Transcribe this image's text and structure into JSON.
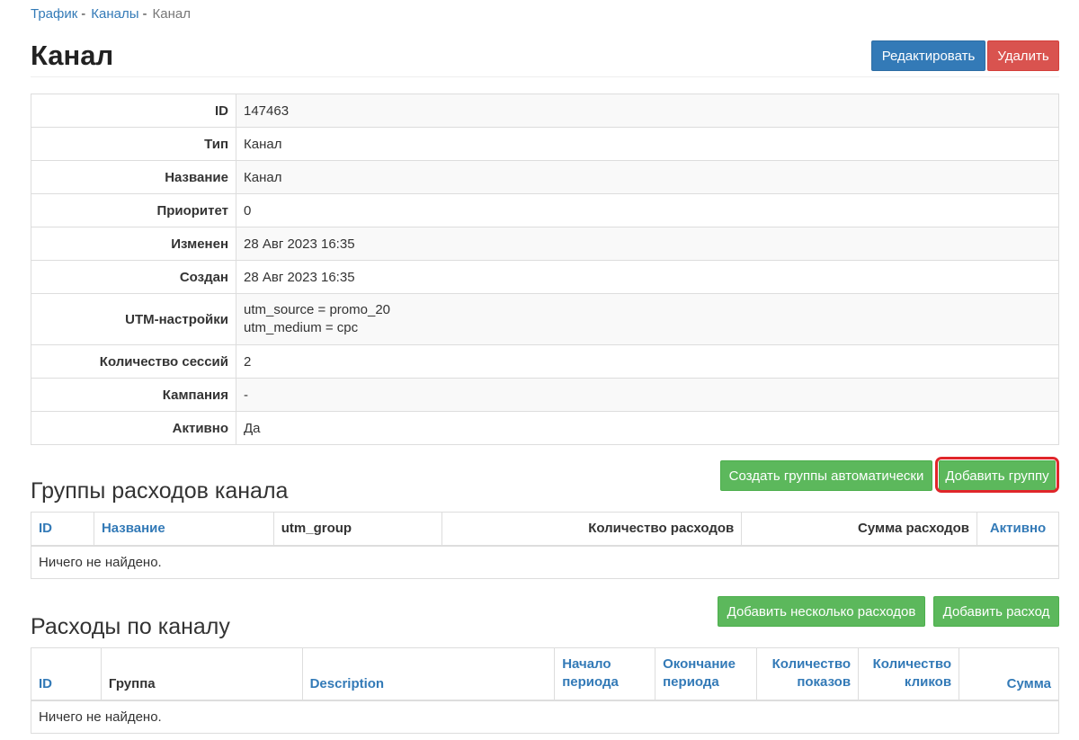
{
  "breadcrumb": {
    "items": [
      "Трафик",
      "Каналы"
    ],
    "current": "Канал",
    "sep": "-"
  },
  "page": {
    "title": "Канал"
  },
  "actions": {
    "edit": "Редактировать",
    "delete": "Удалить"
  },
  "detail": {
    "rows": [
      {
        "label": "ID",
        "value": "147463"
      },
      {
        "label": "Тип",
        "value": "Канал"
      },
      {
        "label": "Название",
        "value": "Канал"
      },
      {
        "label": "Приоритет",
        "value": "0"
      },
      {
        "label": "Изменен",
        "value": "28 Авг 2023 16:35"
      },
      {
        "label": "Создан",
        "value": "28 Авг 2023 16:35"
      },
      {
        "label": "UTM-настройки",
        "lines": [
          "utm_source = promo_20",
          "utm_medium = cpc"
        ]
      },
      {
        "label": "Количество сессий",
        "value": "2"
      },
      {
        "label": "Кампания",
        "value": "-"
      },
      {
        "label": "Активно",
        "value": "Да"
      }
    ]
  },
  "groups": {
    "title": "Группы расходов канала",
    "auto_button": "Создать группы автоматически",
    "add_button": "Добавить группу",
    "columns": [
      "ID",
      "Название",
      "utm_group",
      "Количество расходов",
      "Сумма расходов",
      "Активно"
    ],
    "empty": "Ничего не найдено."
  },
  "expenses": {
    "title": "Расходы по каналу",
    "add_many_button": "Добавить несколько расходов",
    "add_button": "Добавить расход",
    "columns": [
      {
        "l1": "ID"
      },
      {
        "l1": "Группа"
      },
      {
        "l1": "Description"
      },
      {
        "l1": "Начало",
        "l2": "периода"
      },
      {
        "l1": "Окончание",
        "l2": "периода"
      },
      {
        "l1": "Количество",
        "l2": "показов"
      },
      {
        "l1": "Количество",
        "l2": "кликов"
      },
      {
        "l1": "Сумма"
      }
    ],
    "empty": "Ничего не найдено."
  },
  "colors": {
    "link": "#337ab7",
    "primary": "#337ab7",
    "danger": "#d9534f",
    "success": "#5cb85c",
    "highlight": "#e0262a"
  }
}
